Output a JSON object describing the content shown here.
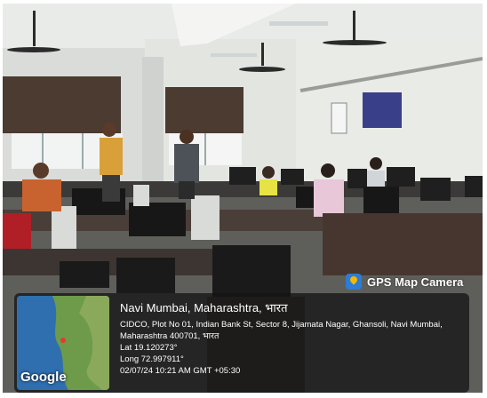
{
  "photo_description_icons": {
    "camera_badge_icon": "map-pin-icon"
  },
  "badge": {
    "label": "GPS Map Camera"
  },
  "location": {
    "place": "Navi Mumbai, Maharashtra, भारत",
    "address": "CIDCO, Plot No 01, Indian Bank St, Sector 8, Jijamata Nagar, Ghansoli, Navi Mumbai, Maharashtra 400701, भारत",
    "latitude": "Lat 19.120273°",
    "longitude": "Long 72.997911°",
    "datetime": "02/07/24 10:21 AM GMT +05:30"
  },
  "map": {
    "brand": "Google"
  },
  "colors": {
    "overlay": "#141414",
    "badge_icon": "#2d7cd6"
  }
}
